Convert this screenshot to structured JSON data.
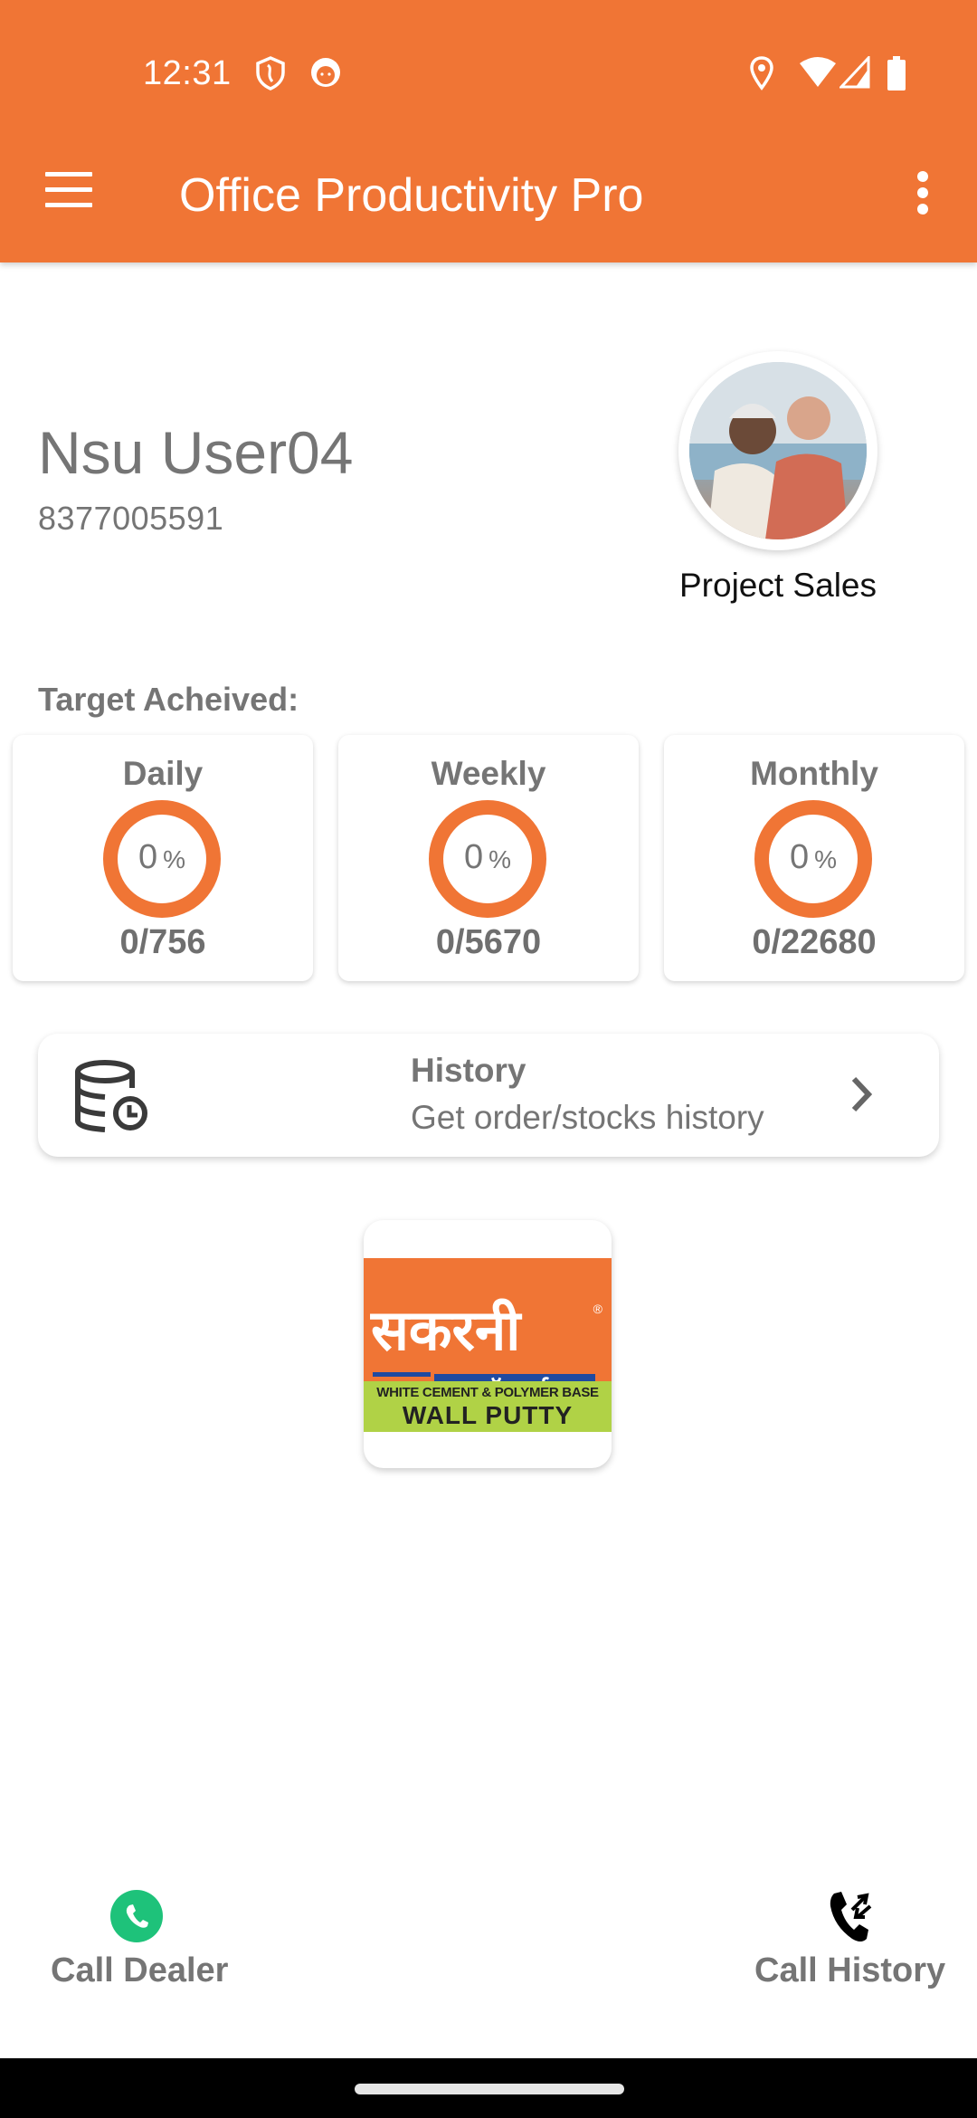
{
  "status_bar": {
    "time": "12:31",
    "left_icons": [
      "shield-icon",
      "cat-icon"
    ],
    "right_icons": [
      "location-icon",
      "wifi-icon",
      "signal-icon",
      "battery-icon"
    ]
  },
  "app_bar": {
    "title": "Office Productivity Pro",
    "menu_icon": "hamburger-menu-icon",
    "more_icon": "more-vert-icon"
  },
  "profile": {
    "name": "Nsu User04",
    "phone": "8377005591",
    "role": "Project Sales",
    "avatar_alt": "profile-photo"
  },
  "targets": {
    "label": "Target Acheived:",
    "accent": "#F07535",
    "items": [
      {
        "label": "Daily",
        "percent": "0",
        "percent_sign": "%",
        "count": "0/756"
      },
      {
        "label": "Weekly",
        "percent": "0",
        "percent_sign": "%",
        "count": "0/5670"
      },
      {
        "label": "Monthly",
        "percent": "0",
        "percent_sign": "%",
        "count": "0/22680"
      }
    ]
  },
  "history": {
    "title": "History",
    "subtitle": "Get order/stocks history",
    "icon": "database-clock-icon",
    "chevron": "chevron-right-icon"
  },
  "brand_logo": {
    "hindi_name": "सकरनी",
    "hindi_sub": "वॉलगार्ड",
    "registered": "®",
    "line1": "WHITE CEMENT & POLYMER BASE",
    "line2": "WALL PUTTY"
  },
  "bottom_actions": {
    "call_dealer": "Call Dealer",
    "call_history": "Call History",
    "call_dealer_color": "#1EC27A"
  },
  "colors": {
    "primary": "#F07535",
    "text_gray": "#757575"
  }
}
